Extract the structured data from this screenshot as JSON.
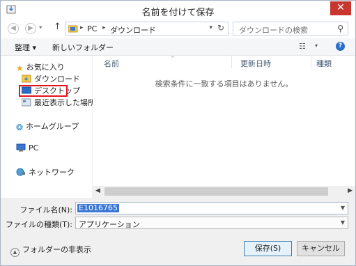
{
  "window": {
    "title": "名前を付けて保存",
    "close_glyph": "✕"
  },
  "address": {
    "crumbs": [
      "PC",
      "ダウンロード"
    ],
    "search_placeholder": "ダウンロードの検索"
  },
  "toolbar": {
    "organize": "整理 ▾",
    "new_folder": "新しいフォルダー"
  },
  "nav": {
    "favorites": "お気に入り",
    "downloads": "ダウンロード",
    "desktop": "デスクトップ",
    "recent": "最近表示した場所",
    "homegroup": "ホームグループ",
    "pc": "PC",
    "network": "ネットワーク"
  },
  "filelist": {
    "columns": [
      "名前",
      "更新日時",
      "種類"
    ],
    "empty_message": "検索条件に一致する項目はありません。"
  },
  "form": {
    "filename_label": "ファイル名(N):",
    "filename_value": "E1016765",
    "filetype_label": "ファイルの種類(T):",
    "filetype_value": "アプリケーション"
  },
  "footer": {
    "hide_folders": "フォルダーの非表示",
    "save": "保存(S)",
    "cancel": "キャンセル"
  },
  "colors": {
    "accent": "#3a77d5",
    "highlight_box": "#e2141c",
    "close": "#c7372f"
  }
}
